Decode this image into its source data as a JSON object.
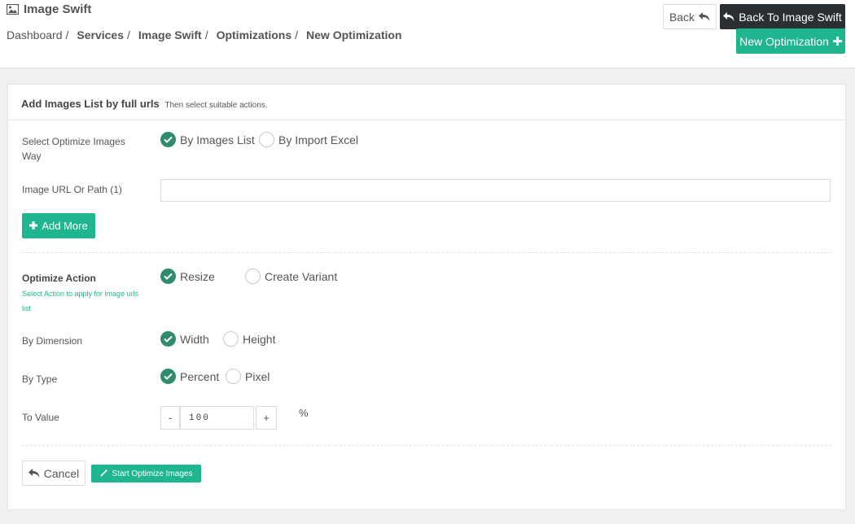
{
  "header": {
    "app_title": "Image Swift",
    "breadcrumb": [
      {
        "label": "Dashboard",
        "bold": false
      },
      {
        "label": "Services",
        "bold": true
      },
      {
        "label": "Image Swift",
        "bold": true
      },
      {
        "label": "Optimizations",
        "bold": true
      },
      {
        "label": "New Optimization",
        "bold": true
      }
    ],
    "separator": "/",
    "back_label": "Back",
    "back_to_swift_label": "Back To Image Swift",
    "new_optimization_label": "New Optimization"
  },
  "panel": {
    "title": "Add Images List by full urls",
    "subtitle": "Then select suitable actions."
  },
  "form": {
    "way_label": "Select Optimize Images Way",
    "way_options": [
      {
        "label": "By Images List",
        "checked": true
      },
      {
        "label": "By Import Excel",
        "checked": false
      }
    ],
    "url_label": "Image URL Or Path (1)",
    "url_value": "",
    "add_more_label": "Add More",
    "action_label": "Optimize Action",
    "action_hint": "Select Action to apply for image urls list",
    "action_options": [
      {
        "label": "Resize",
        "checked": true
      },
      {
        "label": "Create Variant",
        "checked": false
      }
    ],
    "dimension_label": "By Dimension",
    "dimension_options": [
      {
        "label": "Width",
        "checked": true
      },
      {
        "label": "Height",
        "checked": false
      }
    ],
    "type_label": "By Type",
    "type_options": [
      {
        "label": "Percent",
        "checked": true
      },
      {
        "label": "Pixel",
        "checked": false
      }
    ],
    "value_label": "To Value",
    "decrement_label": "-",
    "increment_label": "+",
    "value": "100",
    "unit": "%",
    "cancel_label": "Cancel",
    "start_label": "Start Optimize Images"
  },
  "colors": {
    "accent": "#1fb58f",
    "check": "#2e8b6f",
    "dark_button": "#2a2f33"
  },
  "icons": {
    "title": "image-icon",
    "back": "reply-arrow-icon",
    "add": "plus-icon",
    "start": "magic-wand-icon",
    "checked": "check-icon"
  }
}
